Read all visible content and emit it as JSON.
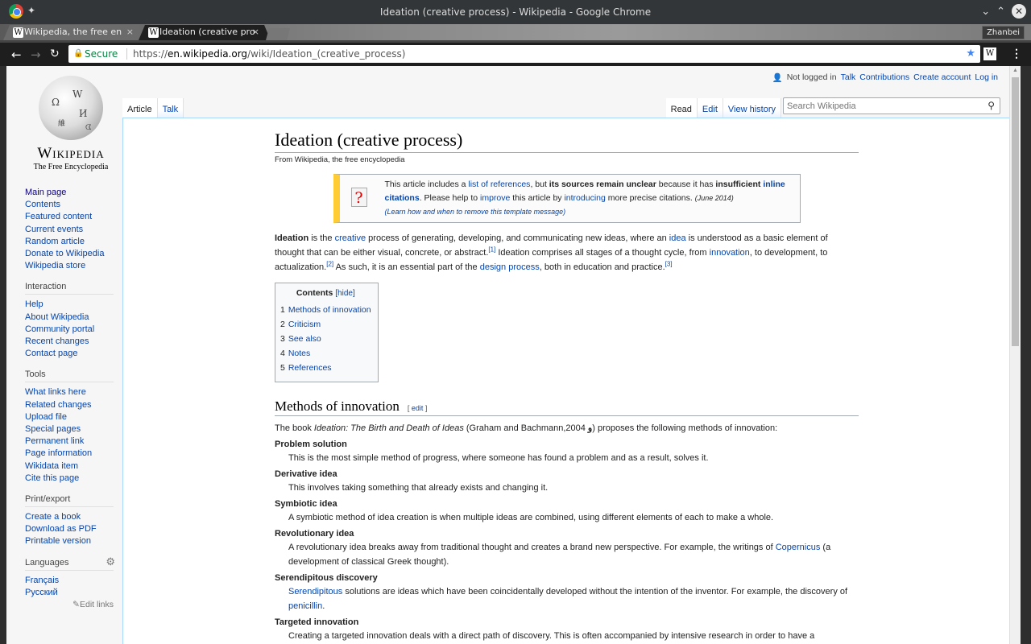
{
  "window": {
    "title": "Ideation (creative process) - Wikipedia - Google Chrome",
    "profile": "Zhanbei"
  },
  "tabs": [
    {
      "title": "Wikipedia, the free en",
      "active": false
    },
    {
      "title": "Ideation (creative pro",
      "active": true
    }
  ],
  "toolbar": {
    "secure_label": "Secure",
    "url_scheme": "https://",
    "url_host": "en.wikipedia.org",
    "url_path": "/wiki/Ideation_(creative_process)"
  },
  "wiki": {
    "wordmark": "Wikipedia",
    "tagline": "The Free Encyclopedia",
    "personal": {
      "not_logged": "Not logged in",
      "talk": "Talk",
      "contributions": "Contributions",
      "create_account": "Create account",
      "log_in": "Log in"
    },
    "ns_tabs": [
      "Article",
      "Talk"
    ],
    "view_tabs": [
      "Read",
      "Edit",
      "View history"
    ],
    "search_placeholder": "Search Wikipedia"
  },
  "sidebar": {
    "navigation": [
      "Main page",
      "Contents",
      "Featured content",
      "Current events",
      "Random article",
      "Donate to Wikipedia",
      "Wikipedia store"
    ],
    "interaction": {
      "heading": "Interaction",
      "items": [
        "Help",
        "About Wikipedia",
        "Community portal",
        "Recent changes",
        "Contact page"
      ]
    },
    "tools": {
      "heading": "Tools",
      "items": [
        "What links here",
        "Related changes",
        "Upload file",
        "Special pages",
        "Permanent link",
        "Page information",
        "Wikidata item",
        "Cite this page"
      ]
    },
    "print": {
      "heading": "Print/export",
      "items": [
        "Create a book",
        "Download as PDF",
        "Printable version"
      ]
    },
    "languages": {
      "heading": "Languages",
      "items": [
        "Français",
        "Русский"
      ],
      "edit_links": "Edit links"
    }
  },
  "article": {
    "title": "Ideation (creative process)",
    "site_sub": "From Wikipedia, the free encyclopedia",
    "ambox": {
      "t1": "This article includes a ",
      "l1": "list of references",
      "t2": ", but ",
      "b1": "its sources remain unclear",
      "t3": " because it has ",
      "b2": "insufficient",
      "l2": "inline citations",
      "t4": ". Please help to ",
      "l3": "improve",
      "t5": " this article by ",
      "l4": "introducing",
      "t6": " more precise citations. ",
      "date": "(June 2014)",
      "learn": "(Learn how and when to remove this template message)"
    },
    "intro": {
      "b": "Ideation",
      "t1": " is the ",
      "l1": "creative",
      "t2": " process of generating, developing, and communicating new ideas, where an ",
      "l2": "idea",
      "t3": " is understood as a basic element of thought that can be either visual, concrete, or abstract.",
      "r1": "[1]",
      "t4": " Ideation comprises all stages of a thought cycle, from ",
      "l3": "innovation",
      "t5": ", to development, to actualization.",
      "r2": "[2]",
      "t6": " As such, it is an essential part of the ",
      "l4": "design process",
      "t7": ", both in education and practice.",
      "r3": "[3]"
    },
    "toc": {
      "title": "Contents",
      "hide": "[hide]",
      "items": [
        {
          "n": "1",
          "label": "Methods of innovation"
        },
        {
          "n": "2",
          "label": "Criticism"
        },
        {
          "n": "3",
          "label": "See also"
        },
        {
          "n": "4",
          "label": "Notes"
        },
        {
          "n": "5",
          "label": "References"
        }
      ]
    },
    "section1": {
      "heading": "Methods of innovation",
      "edit_open": "[ ",
      "edit": "edit",
      "edit_close": " ]",
      "lead_t1": "The book ",
      "lead_i": "Ideation: The Birth and Death of Ideas",
      "lead_t2": " (Graham and Bachmann,2004 ",
      "lead_glyph": "و",
      "lead_t3": ") proposes the following methods of innovation:",
      "methods": [
        {
          "term": "Problem solution",
          "desc": "This is the most simple method of progress, where someone has found a problem and as a result, solves it."
        },
        {
          "term": "Derivative idea",
          "desc": "This involves taking something that already exists and changing it."
        },
        {
          "term": "Symbiotic idea",
          "desc": "A symbiotic method of idea creation is when multiple ideas are combined, using different elements of each to make a whole."
        },
        {
          "term": "Revolutionary idea",
          "desc_t1": "A revolutionary idea breaks away from traditional thought and creates a brand new perspective. For example, the writings of ",
          "desc_l1": "Copernicus",
          "desc_t2": " (a development of classical Greek thought)."
        },
        {
          "term": "Serendipitous discovery",
          "desc_l1": "Serendipitous",
          "desc_t1": " solutions are ideas which have been coincidentally developed without the intention of the inventor. For example, the discovery of ",
          "desc_l2": "penicillin",
          "desc_t2": "."
        },
        {
          "term": "Targeted innovation",
          "desc": "Creating a targeted innovation deals with a direct path of discovery. This is often accompanied by intensive research in order to have a"
        }
      ]
    }
  }
}
